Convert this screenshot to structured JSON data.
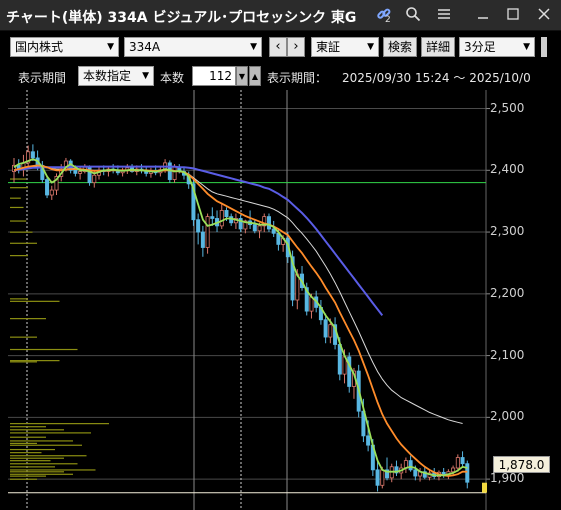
{
  "window": {
    "title": "チャート(単体) 334A ビジュアル･プロセッシンク 東G",
    "link_badge": "2"
  },
  "toolbar": {
    "market_select": "国内株式",
    "code_input": "334A",
    "exchange_select": "東証",
    "search_label": "検索",
    "detail_label": "詳細",
    "interval_select": "3分足"
  },
  "range": {
    "period_label": "表示期間",
    "period_mode": "本数指定",
    "count_label": "本数",
    "count_value": "112",
    "display_label": "表示期間：",
    "display_value": "2025/09/30 15:24 〜 2025/10/0"
  },
  "chart_data": {
    "type": "candlestick",
    "y_ticks": [
      "2,500",
      "2,400",
      "2,300",
      "2,200",
      "2,100",
      "2,000",
      "1,900"
    ],
    "ylim": [
      1850,
      2530
    ],
    "last_price": "1,878.0",
    "support_line": 2380,
    "colors": {
      "up": "#d9776b",
      "down": "#59b7e2",
      "ma_short": "#9be05a",
      "ma_mid": "#ff8c2a",
      "ma_long": "#5a5de6",
      "ma_alt": "#d9d9d9",
      "support": "#33d64a",
      "volume_profile": "#8c8f12"
    },
    "candles": [
      [
        2398,
        2420,
        2380,
        2408
      ],
      [
        2408,
        2418,
        2395,
        2403
      ],
      [
        2403,
        2425,
        2390,
        2412
      ],
      [
        2412,
        2440,
        2405,
        2430
      ],
      [
        2430,
        2442,
        2415,
        2420
      ],
      [
        2420,
        2432,
        2400,
        2408
      ],
      [
        2408,
        2415,
        2380,
        2385
      ],
      [
        2385,
        2390,
        2355,
        2360
      ],
      [
        2360,
        2375,
        2352,
        2368
      ],
      [
        2368,
        2395,
        2360,
        2390
      ],
      [
        2390,
        2410,
        2382,
        2402
      ],
      [
        2402,
        2420,
        2398,
        2415
      ],
      [
        2415,
        2418,
        2395,
        2400
      ],
      [
        2400,
        2408,
        2390,
        2395
      ],
      [
        2395,
        2405,
        2385,
        2398
      ],
      [
        2398,
        2410,
        2395,
        2405
      ],
      [
        2405,
        2408,
        2375,
        2380
      ],
      [
        2380,
        2398,
        2372,
        2392
      ],
      [
        2392,
        2405,
        2385,
        2400
      ],
      [
        2400,
        2408,
        2392,
        2398
      ],
      [
        2398,
        2406,
        2390,
        2402
      ],
      [
        2402,
        2410,
        2395,
        2400
      ],
      [
        2400,
        2408,
        2392,
        2396
      ],
      [
        2396,
        2404,
        2390,
        2400
      ],
      [
        2400,
        2410,
        2394,
        2404
      ],
      [
        2404,
        2410,
        2396,
        2398
      ],
      [
        2398,
        2408,
        2392,
        2402
      ],
      [
        2402,
        2410,
        2395,
        2400
      ],
      [
        2400,
        2406,
        2390,
        2395
      ],
      [
        2395,
        2404,
        2388,
        2400
      ],
      [
        2400,
        2408,
        2392,
        2396
      ],
      [
        2396,
        2405,
        2390,
        2401
      ],
      [
        2401,
        2418,
        2396,
        2412
      ],
      [
        2412,
        2416,
        2380,
        2385
      ],
      [
        2385,
        2410,
        2380,
        2405
      ],
      [
        2405,
        2410,
        2395,
        2398
      ],
      [
        2398,
        2404,
        2385,
        2392
      ],
      [
        2392,
        2398,
        2370,
        2378
      ],
      [
        2378,
        2385,
        2310,
        2320
      ],
      [
        2320,
        2330,
        2280,
        2300
      ],
      [
        2300,
        2310,
        2260,
        2275
      ],
      [
        2275,
        2330,
        2265,
        2325
      ],
      [
        2325,
        2340,
        2310,
        2322
      ],
      [
        2322,
        2335,
        2300,
        2310
      ],
      [
        2310,
        2345,
        2305,
        2335
      ],
      [
        2335,
        2340,
        2318,
        2325
      ],
      [
        2325,
        2330,
        2310,
        2315
      ],
      [
        2315,
        2330,
        2305,
        2322
      ],
      [
        2322,
        2328,
        2300,
        2305
      ],
      [
        2305,
        2320,
        2298,
        2318
      ],
      [
        2318,
        2335,
        2305,
        2312
      ],
      [
        2312,
        2320,
        2298,
        2302
      ],
      [
        2302,
        2315,
        2290,
        2310
      ],
      [
        2310,
        2330,
        2300,
        2325
      ],
      [
        2325,
        2330,
        2300,
        2305
      ],
      [
        2305,
        2318,
        2292,
        2298
      ],
      [
        2298,
        2305,
        2270,
        2280
      ],
      [
        2280,
        2295,
        2268,
        2290
      ],
      [
        2290,
        2300,
        2250,
        2260
      ],
      [
        2260,
        2270,
        2180,
        2190
      ],
      [
        2190,
        2240,
        2175,
        2232
      ],
      [
        2232,
        2245,
        2205,
        2210
      ],
      [
        2210,
        2218,
        2165,
        2172
      ],
      [
        2172,
        2200,
        2160,
        2195
      ],
      [
        2195,
        2205,
        2170,
        2178
      ],
      [
        2178,
        2190,
        2150,
        2158
      ],
      [
        2158,
        2168,
        2120,
        2130
      ],
      [
        2130,
        2160,
        2120,
        2150
      ],
      [
        2150,
        2162,
        2110,
        2118
      ],
      [
        2118,
        2130,
        2060,
        2070
      ],
      [
        2070,
        2110,
        2055,
        2098
      ],
      [
        2098,
        2105,
        2040,
        2050
      ],
      [
        2050,
        2080,
        2030,
        2075
      ],
      [
        2075,
        2085,
        2000,
        2010
      ],
      [
        2010,
        2030,
        1960,
        1970
      ],
      [
        1970,
        1995,
        1945,
        1955
      ],
      [
        1955,
        1965,
        1905,
        1915
      ],
      [
        1915,
        1930,
        1880,
        1890
      ],
      [
        1890,
        1920,
        1885,
        1915
      ],
      [
        1915,
        1935,
        1898,
        1902
      ],
      [
        1902,
        1925,
        1895,
        1920
      ],
      [
        1920,
        1930,
        1905,
        1910
      ],
      [
        1910,
        1925,
        1900,
        1918
      ],
      [
        1918,
        1935,
        1910,
        1930
      ],
      [
        1930,
        1938,
        1912,
        1915
      ],
      [
        1915,
        1922,
        1898,
        1905
      ],
      [
        1905,
        1918,
        1896,
        1912
      ],
      [
        1912,
        1920,
        1900,
        1903
      ],
      [
        1903,
        1915,
        1898,
        1910
      ],
      [
        1910,
        1918,
        1900,
        1904
      ],
      [
        1904,
        1914,
        1898,
        1911
      ],
      [
        1911,
        1918,
        1902,
        1906
      ],
      [
        1906,
        1916,
        1900,
        1912
      ],
      [
        1912,
        1922,
        1905,
        1918
      ],
      [
        1918,
        1940,
        1912,
        1935
      ],
      [
        1935,
        1945,
        1918,
        1925
      ],
      [
        1925,
        1930,
        1885,
        1895
      ]
    ],
    "ma_short": [
      2405,
      2410,
      2412,
      2415,
      2418,
      2415,
      2405,
      2390,
      2380,
      2385,
      2395,
      2405,
      2410,
      2405,
      2400,
      2400,
      2398,
      2395,
      2397,
      2400,
      2400,
      2401,
      2400,
      2399,
      2400,
      2401,
      2400,
      2400,
      2399,
      2398,
      2398,
      2399,
      2402,
      2400,
      2398,
      2399,
      2397,
      2390,
      2370,
      2345,
      2320,
      2310,
      2312,
      2315,
      2318,
      2322,
      2322,
      2320,
      2318,
      2316,
      2315,
      2314,
      2312,
      2312,
      2312,
      2308,
      2300,
      2290,
      2280,
      2250,
      2230,
      2220,
      2205,
      2195,
      2188,
      2178,
      2165,
      2155,
      2145,
      2120,
      2100,
      2085,
      2070,
      2045,
      2015,
      1985,
      1955,
      1930,
      1915,
      1912,
      1912,
      1912,
      1914,
      1918,
      1920,
      1918,
      1912,
      1910,
      1908,
      1906,
      1906,
      1906,
      1908,
      1910,
      1914,
      1920,
      1918
    ],
    "ma_mid": [
      2400,
      2402,
      2404,
      2406,
      2407,
      2408,
      2407,
      2405,
      2402,
      2400,
      2400,
      2401,
      2402,
      2402,
      2402,
      2401,
      2400,
      2399,
      2399,
      2399,
      2400,
      2400,
      2400,
      2400,
      2400,
      2400,
      2400,
      2400,
      2400,
      2399,
      2399,
      2399,
      2400,
      2400,
      2399,
      2398,
      2397,
      2393,
      2386,
      2378,
      2370,
      2362,
      2356,
      2350,
      2346,
      2342,
      2338,
      2334,
      2330,
      2326,
      2323,
      2320,
      2317,
      2314,
      2312,
      2309,
      2305,
      2300,
      2295,
      2285,
      2275,
      2266,
      2255,
      2244,
      2234,
      2223,
      2210,
      2198,
      2186,
      2170,
      2155,
      2140,
      2125,
      2108,
      2088,
      2068,
      2046,
      2024,
      2005,
      1990,
      1978,
      1966,
      1956,
      1948,
      1940,
      1933,
      1926,
      1920,
      1915,
      1911,
      1908,
      1906,
      1905,
      1906,
      1908,
      1912,
      1912
    ],
    "ma_long": [
      2400,
      2401,
      2402,
      2403,
      2404,
      2404,
      2405,
      2405,
      2405,
      2405,
      2405,
      2405,
      2406,
      2406,
      2406,
      2406,
      2406,
      2406,
      2406,
      2406,
      2406,
      2406,
      2406,
      2406,
      2406,
      2406,
      2406,
      2406,
      2406,
      2406,
      2406,
      2406,
      2406,
      2406,
      2406,
      2405,
      2405,
      2404,
      2403,
      2401,
      2399,
      2397,
      2395,
      2393,
      2391,
      2389,
      2387,
      2385,
      2383,
      2381,
      2379,
      2377,
      2375,
      2372,
      2370,
      2366,
      2362,
      2357,
      2352,
      2345,
      2338,
      2331,
      2323,
      2314,
      2305,
      2295,
      2285,
      2275,
      2265,
      2255,
      2245,
      2235,
      2225,
      2215,
      2205,
      2195,
      2185,
      2175,
      2165
    ],
    "ma_alt": [
      2400,
      2402,
      2404,
      2405,
      2406,
      2406,
      2405,
      2404,
      2403,
      2402,
      2402,
      2402,
      2403,
      2403,
      2402,
      2401,
      2400,
      2400,
      2400,
      2400,
      2400,
      2400,
      2400,
      2400,
      2400,
      2400,
      2400,
      2400,
      2400,
      2399,
      2399,
      2399,
      2400,
      2400,
      2399,
      2398,
      2397,
      2394,
      2388,
      2382,
      2376,
      2370,
      2365,
      2362,
      2360,
      2358,
      2356,
      2354,
      2352,
      2350,
      2348,
      2346,
      2344,
      2342,
      2340,
      2337,
      2333,
      2328,
      2323,
      2315,
      2306,
      2298,
      2289,
      2279,
      2269,
      2257,
      2245,
      2232,
      2218,
      2203,
      2187,
      2171,
      2155,
      2139,
      2122,
      2105,
      2089,
      2074,
      2062,
      2052,
      2044,
      2038,
      2032,
      2028,
      2024,
      2020,
      2016,
      2012,
      2008,
      2005,
      2002,
      1999,
      1996,
      1994,
      1992,
      1990
    ],
    "volume_profile": [
      [
        1990,
        110
      ],
      [
        1985,
        40
      ],
      [
        1980,
        60
      ],
      [
        1975,
        90
      ],
      [
        1968,
        40
      ],
      [
        1962,
        70
      ],
      [
        1958,
        30
      ],
      [
        1955,
        80
      ],
      [
        1948,
        50
      ],
      [
        1943,
        35
      ],
      [
        1938,
        85
      ],
      [
        1934,
        60
      ],
      [
        1930,
        45
      ],
      [
        1925,
        75
      ],
      [
        1920,
        50
      ],
      [
        1915,
        95
      ],
      [
        1912,
        60
      ],
      [
        1908,
        70
      ],
      [
        1905,
        40
      ],
      [
        1900,
        30
      ],
      [
        2092,
        55
      ],
      [
        2090,
        30
      ],
      [
        2110,
        75
      ],
      [
        2130,
        30
      ],
      [
        2160,
        40
      ],
      [
        2188,
        55
      ],
      [
        2192,
        20
      ],
      [
        2262,
        20
      ],
      [
        2282,
        30
      ],
      [
        2300,
        25
      ],
      [
        2318,
        18
      ],
      [
        2340,
        15
      ],
      [
        2355,
        12
      ],
      [
        2372,
        20
      ],
      [
        2386,
        18
      ]
    ]
  }
}
